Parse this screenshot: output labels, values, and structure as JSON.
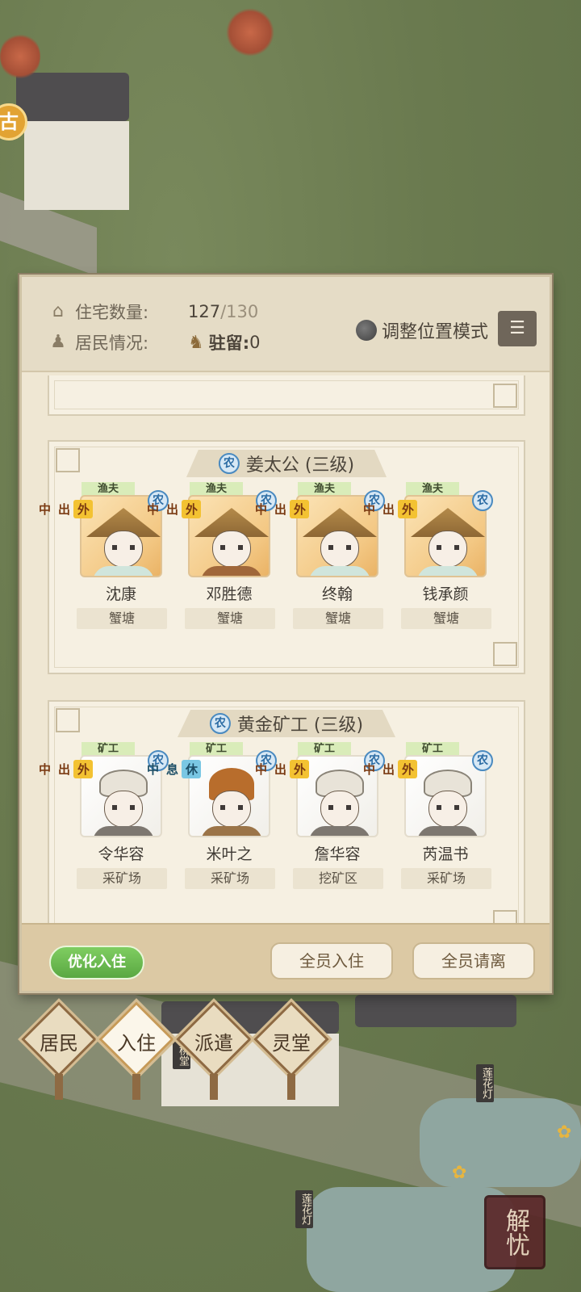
{
  "colors": {
    "panel_bg": "#efe7d3",
    "accent_green": "#5aa842",
    "status_out": "#f3c232",
    "status_rest": "#7ac7e3",
    "nong_blue": "#4a8ac0"
  },
  "stats": {
    "housing_label": "住宅数量:",
    "housing_current": "127",
    "housing_max": "/130",
    "residents_label": "居民情况:",
    "stay_label": "驻留:",
    "stay_value": "0",
    "adjust_mode_label": "调整位置模式"
  },
  "groups": [
    {
      "badge": "农",
      "title": "姜太公 (三级)",
      "members": [
        {
          "job": "渔夫",
          "status": "外出中",
          "badge": "农",
          "name": "沈康",
          "place": "蟹塘"
        },
        {
          "job": "渔夫",
          "status": "外出中",
          "badge": "农",
          "name": "邓胜德",
          "place": "蟹塘"
        },
        {
          "job": "渔夫",
          "status": "外出中",
          "badge": "农",
          "name": "终翰",
          "place": "蟹塘"
        },
        {
          "job": "渔夫",
          "status": "外出中",
          "badge": "农",
          "name": "钱承颜",
          "place": "蟹塘"
        }
      ]
    },
    {
      "badge": "农",
      "title": "黄金矿工 (三级)",
      "members": [
        {
          "job": "矿工",
          "status": "外出中",
          "badge": "农",
          "name": "令华容",
          "place": "采矿场"
        },
        {
          "job": "矿工",
          "status": "休息中",
          "badge": "农",
          "name": "米叶之",
          "place": "采矿场"
        },
        {
          "job": "矿工",
          "status": "外出中",
          "badge": "农",
          "name": "詹华容",
          "place": "挖矿区"
        },
        {
          "job": "矿工",
          "status": "外出中",
          "badge": "农",
          "name": "芮温书",
          "place": "采矿场"
        }
      ]
    }
  ],
  "footer": {
    "optimize_label": "优化入住",
    "all_move_in_label": "全员入住",
    "all_leave_label": "全员请离"
  },
  "nav": [
    {
      "label": "居民"
    },
    {
      "label": "入住"
    },
    {
      "label": "派遣"
    },
    {
      "label": "灵堂"
    }
  ],
  "map": {
    "gold_badge": "古",
    "sign_1": "桃堂",
    "sign_2": "莲花灯",
    "sign_3": "莲花灯",
    "jieyou_label": "解忧"
  }
}
